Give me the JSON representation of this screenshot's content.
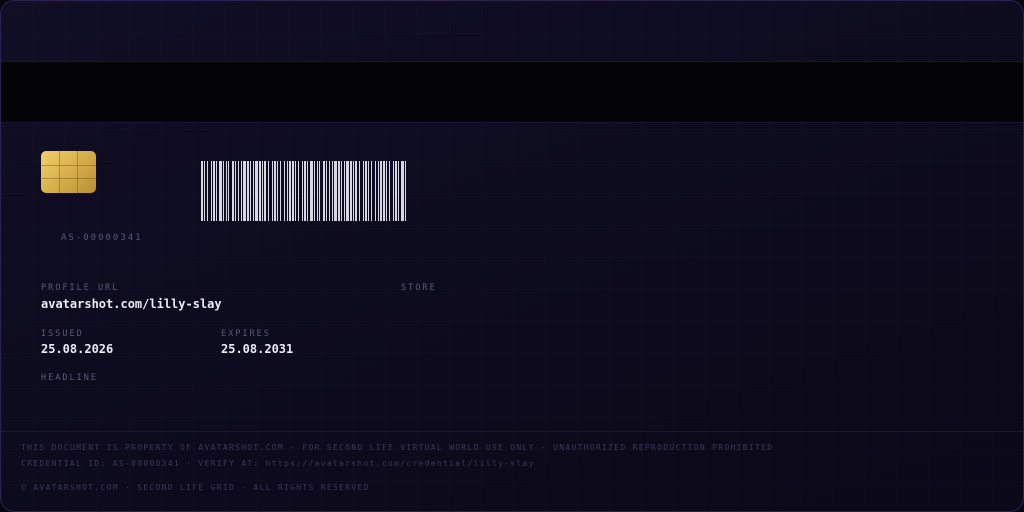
{
  "card": {
    "serial": "AS-00000341",
    "chip_icon": "smart-chip-icon",
    "barcode_icon": "barcode-icon",
    "colors": {
      "accent_gold": "#d9b24e",
      "card_bg": "#0d0b1e",
      "stripe": "#040306",
      "text_primary": "#eceaf4",
      "text_muted": "#5e5879"
    }
  },
  "fields": {
    "profile_url_label": "PROFILE URL",
    "profile_url_value": "avatarshot.com/lilly-slay",
    "store_label": "STORE",
    "issued_label": "ISSUED",
    "issued_value": "25.08.2026",
    "expires_label": "EXPIRES",
    "expires_value": "25.08.2031",
    "headline_label": "HEADLINE"
  },
  "footer": {
    "line1": "THIS DOCUMENT IS PROPERTY OF AVATARSHOT.COM · FOR SECOND LIFE VIRTUAL WORLD USE ONLY · UNAUTHORIZED REPRODUCTION PROHIBITED",
    "line2": "CREDENTIAL ID: AS-00000341 · VERIFY AT: https://avatarshot.com/credential/lilly-slay",
    "line3": "© AVATARSHOT.COM · SECOND LIFE GRID · ALL RIGHTS RESERVED"
  }
}
